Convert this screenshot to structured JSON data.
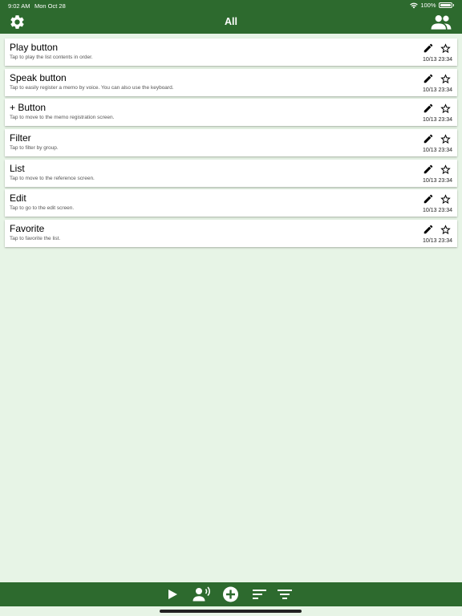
{
  "status_bar": {
    "time": "9:02 AM",
    "date": "Mon Oct 28",
    "battery": "100%"
  },
  "header": {
    "title": "All",
    "left_icon": "gear-icon",
    "right_icon": "users-icon"
  },
  "memos": [
    {
      "title": "Play button",
      "description": "Tap to play the list contents in order.",
      "timestamp": "10/13 23:34"
    },
    {
      "title": "Speak button",
      "description": "Tap to easily register a memo by voice. You can also use the keyboard.",
      "timestamp": "10/13 23:34"
    },
    {
      "title": "+ Button",
      "description": "Tap to move to the memo registration screen.",
      "timestamp": "10/13 23:34"
    },
    {
      "title": "Filter",
      "description": "Tap to filter by group.",
      "timestamp": "10/13 23:34"
    },
    {
      "title": "List",
      "description": "Tap to move to the reference screen.",
      "timestamp": "10/13 23:34"
    },
    {
      "title": "Edit",
      "description": "Tap to go to the edit screen.",
      "timestamp": "10/13 23:34"
    },
    {
      "title": "Favorite",
      "description": "Tap to favorite the list.",
      "timestamp": "10/13 23:34"
    }
  ],
  "toolbar": {
    "icons": [
      "play-icon",
      "speak-icon",
      "add-icon",
      "list-icon",
      "filter-icon"
    ]
  },
  "colors": {
    "header_bg": "#2d6a2e",
    "page_bg": "#e7f4e6",
    "card_bg": "#ffffff"
  }
}
